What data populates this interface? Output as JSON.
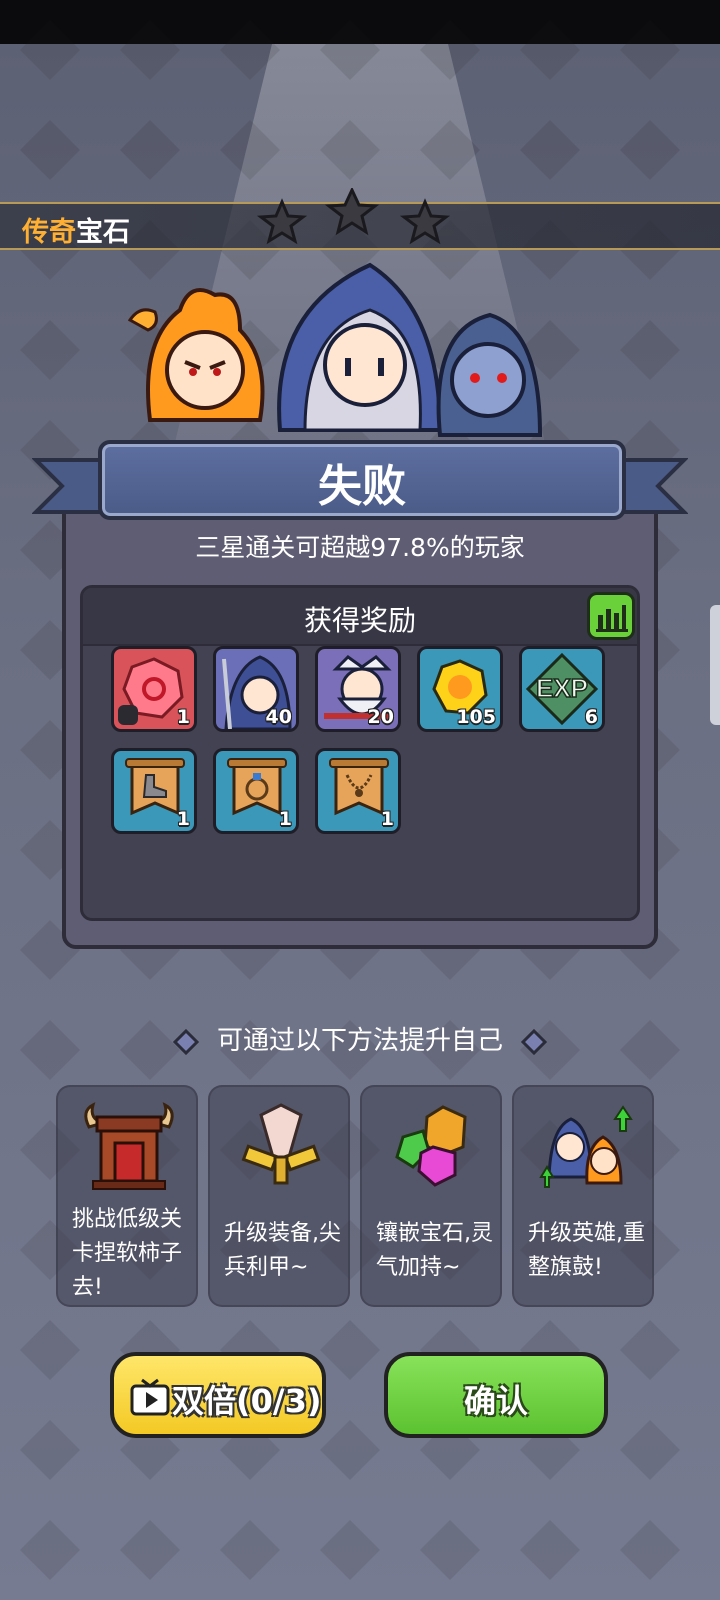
{
  "mode": {
    "title_highlight": "传奇",
    "title_rest": "宝石"
  },
  "stars": {
    "earned": 0,
    "total": 3
  },
  "result": {
    "title": "失败",
    "stat_line": "三星通关可超越97.8%的玩家"
  },
  "rewards": {
    "title": "获得奖励",
    "items": [
      {
        "name": "red-gem-shard",
        "quantity": "1"
      },
      {
        "name": "blue-mage-hero-shard",
        "quantity": "40"
      },
      {
        "name": "white-elder-hero-shard",
        "quantity": "20"
      },
      {
        "name": "gold-coin",
        "quantity": "105"
      },
      {
        "name": "exp",
        "label": "EXP",
        "quantity": "6"
      },
      {
        "name": "boot-blueprint",
        "quantity": "1"
      },
      {
        "name": "ring-blueprint",
        "quantity": "1"
      },
      {
        "name": "necklace-blueprint",
        "quantity": "1"
      }
    ]
  },
  "improve": {
    "title": "可通过以下方法提升自己",
    "cards": [
      {
        "text": "挑战低级关卡捏软柿子去!"
      },
      {
        "text": "升级装备,尖兵利甲~"
      },
      {
        "text": "镶嵌宝石,灵气加持~"
      },
      {
        "text": "升级英雄,重整旗鼓!"
      }
    ]
  },
  "buttons": {
    "double_label": "双倍(0/3)",
    "confirm_label": "确认"
  },
  "colors": {
    "accent_orange": "#ffb033",
    "ribbon_blue": "#5d6fa0",
    "confirm_green": "#5cc230",
    "double_yellow": "#f3c924"
  }
}
